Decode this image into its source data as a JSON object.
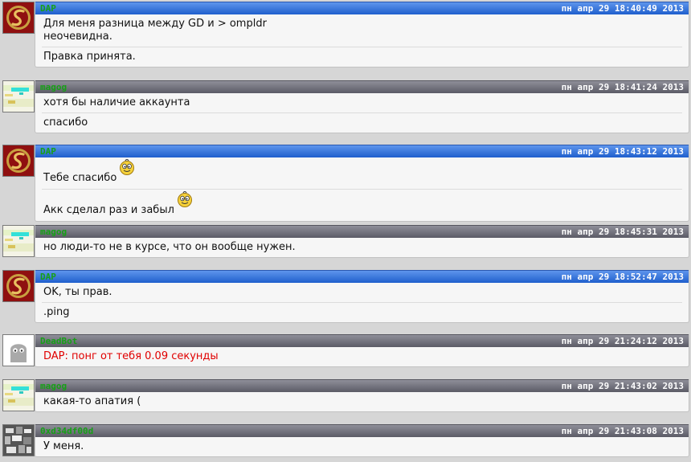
{
  "colors": {
    "nick": "#16a016",
    "header_blue": "#2f6fd8",
    "header_gray": "#6e6e78",
    "error_text": "#e00000"
  },
  "messages": [
    {
      "author": "DAP",
      "time": "пн апр 29 18:40:49 2013",
      "avatar": "dragon-logo-icon",
      "lines": [
        "Для меня разница между GD и > ompldr\nнеочевидна.",
        "Правка принята."
      ]
    },
    {
      "author": "magog",
      "time": "пн апр 29 18:41:24 2013",
      "avatar": "landscape-thumbnail-icon",
      "lines": [
        "хотя бы наличие аккаунта",
        "спасибо"
      ]
    },
    {
      "author": "DAP",
      "time": "пн апр 29 18:43:12 2013",
      "avatar": "dragon-logo-icon",
      "lines": [
        "Тебе спасибо",
        "Акк сделал раз и забыл"
      ]
    },
    {
      "author": "magog",
      "time": "пн апр 29 18:45:31 2013",
      "avatar": "landscape-thumbnail-icon",
      "lines": [
        "но люди-то не в курсе, что он вообще нужен."
      ]
    },
    {
      "author": "DAP",
      "time": "пн апр 29 18:52:47 2013",
      "avatar": "dragon-logo-icon",
      "lines": [
        "OK, ты прав.",
        ".ping"
      ]
    },
    {
      "author": "DeadBot",
      "time": "пн апр 29 21:24:12 2013",
      "avatar": "default-user-icon",
      "lines": [
        "DAP: понг от тебя 0.09 секунды"
      ]
    },
    {
      "author": "magog",
      "time": "пн апр 29 21:43:02 2013",
      "avatar": "landscape-thumbnail-icon",
      "lines": [
        "какая-то апатия ("
      ]
    },
    {
      "author": "0xd34df00d",
      "time": "пн апр 29 21:43:08 2013",
      "avatar": "noise-photo-icon",
      "lines": [
        "У меня."
      ]
    }
  ]
}
